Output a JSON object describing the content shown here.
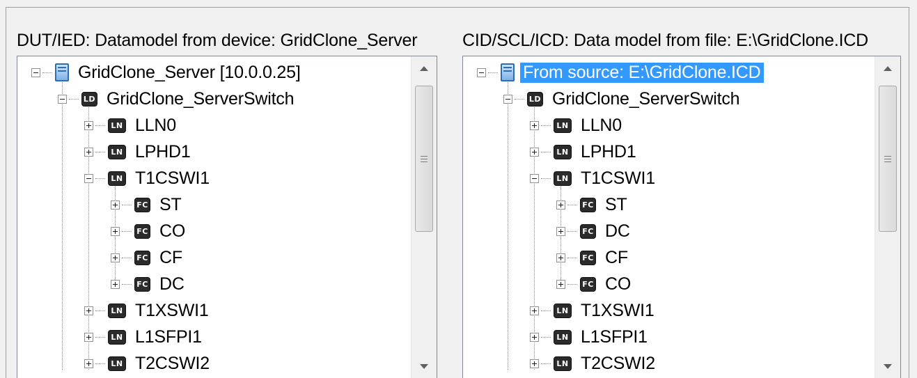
{
  "left_panel": {
    "title": "DUT/IED: Datamodel from device: GridClone_Server",
    "root": "GridClone_Server [10.0.0.25]",
    "ld": "GridClone_ServerSwitch",
    "badges": {
      "ld": "LD",
      "ln": "LN",
      "fc": "FC"
    },
    "items": [
      {
        "level": "ln",
        "label": "LLN0",
        "expanded": false
      },
      {
        "level": "ln",
        "label": "LPHD1",
        "expanded": false
      },
      {
        "level": "ln",
        "label": "T1CSWI1",
        "expanded": true
      },
      {
        "level": "fc",
        "label": "ST",
        "expanded": false
      },
      {
        "level": "fc",
        "label": "CO",
        "expanded": false
      },
      {
        "level": "fc",
        "label": "CF",
        "expanded": false
      },
      {
        "level": "fc",
        "label": "DC",
        "expanded": false
      },
      {
        "level": "ln",
        "label": "T1XSWI1",
        "expanded": false
      },
      {
        "level": "ln",
        "label": "L1SFPI1",
        "expanded": false
      },
      {
        "level": "ln",
        "label": "T2CSWI2",
        "expanded": false
      }
    ]
  },
  "right_panel": {
    "title": "CID/SCL/ICD: Data model from file: E:\\GridClone.ICD",
    "root": "From source: E:\\GridClone.ICD",
    "ld": "GridClone_ServerSwitch",
    "badges": {
      "ld": "LD",
      "ln": "LN",
      "fc": "FC"
    },
    "items": [
      {
        "level": "ln",
        "label": "LLN0",
        "expanded": false
      },
      {
        "level": "ln",
        "label": "LPHD1",
        "expanded": false
      },
      {
        "level": "ln",
        "label": "T1CSWI1",
        "expanded": true
      },
      {
        "level": "fc",
        "label": "ST",
        "expanded": false
      },
      {
        "level": "fc",
        "label": "DC",
        "expanded": false
      },
      {
        "level": "fc",
        "label": "CF",
        "expanded": false
      },
      {
        "level": "fc",
        "label": "CO",
        "expanded": false
      },
      {
        "level": "ln",
        "label": "T1XSWI1",
        "expanded": false
      },
      {
        "level": "ln",
        "label": "L1SFPI1",
        "expanded": false
      },
      {
        "level": "ln",
        "label": "T2CSWI2",
        "expanded": false
      }
    ]
  },
  "colors": {
    "selection": "#3399ff",
    "badge": "#2b2b2b",
    "server_icon": "#2a6fb5"
  }
}
